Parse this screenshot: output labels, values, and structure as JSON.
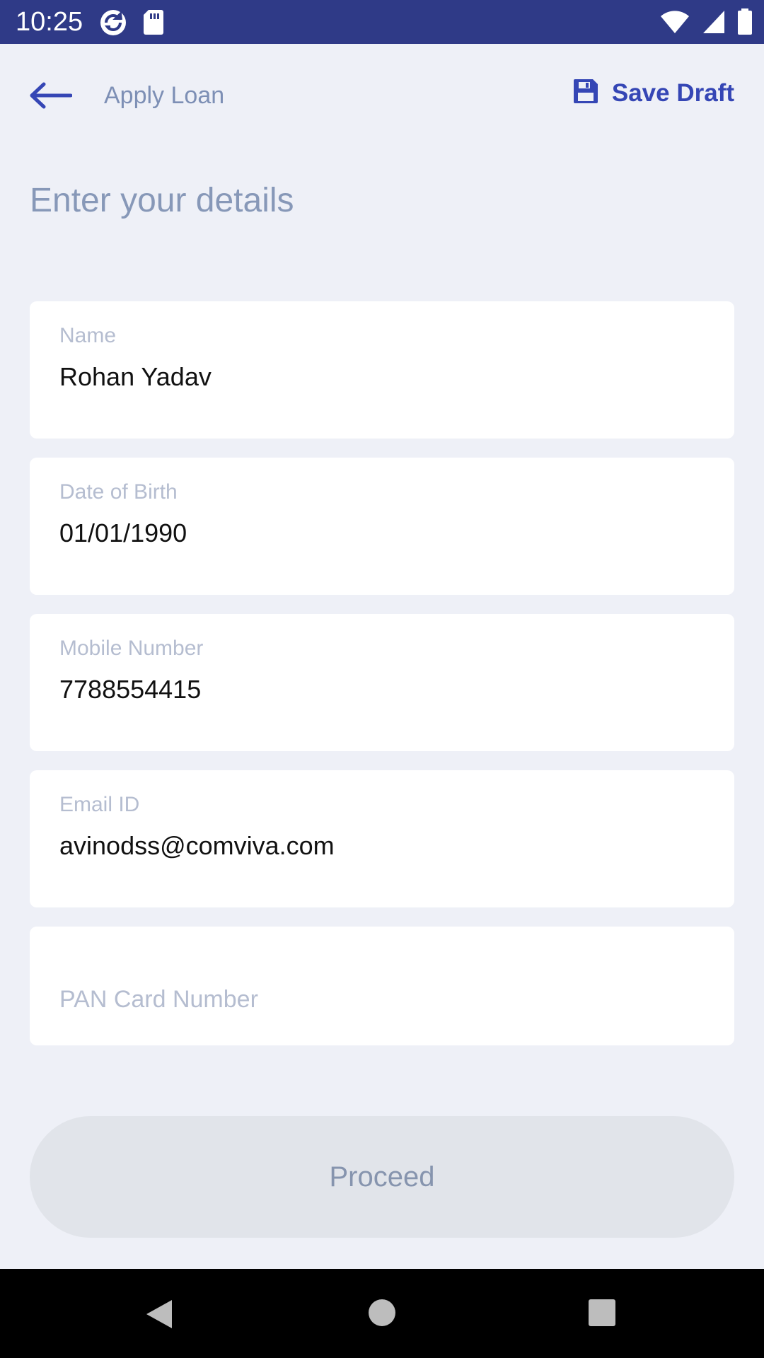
{
  "status_bar": {
    "time": "10:25",
    "icons": [
      "sync-icon",
      "sd-card-icon",
      "wifi-icon",
      "signal-icon",
      "battery-icon"
    ]
  },
  "header": {
    "back_icon": "arrow-left-icon",
    "title": "Apply Loan",
    "save_icon": "floppy-disk-icon",
    "save_label": "Save Draft"
  },
  "page": {
    "title": "Enter your details"
  },
  "form": {
    "name": {
      "label": "Name",
      "value": "Rohan Yadav"
    },
    "dob": {
      "label": "Date of Birth",
      "value": "01/01/1990"
    },
    "mobile": {
      "label": "Mobile Number",
      "value": "7788554415"
    },
    "email": {
      "label": "Email ID",
      "value": "avinodss@comviva.com"
    },
    "pan": {
      "placeholder": "PAN Card Number"
    }
  },
  "actions": {
    "proceed_label": "Proceed"
  },
  "nav_bar": {
    "icons": [
      "nav-back-icon",
      "nav-home-icon",
      "nav-recents-icon"
    ]
  },
  "colors": {
    "status_bar": "#2f3a87",
    "background": "#eef0f7",
    "accent": "#3546b5",
    "muted_text": "#8798b8",
    "button_disabled": "#e1e4ea"
  }
}
